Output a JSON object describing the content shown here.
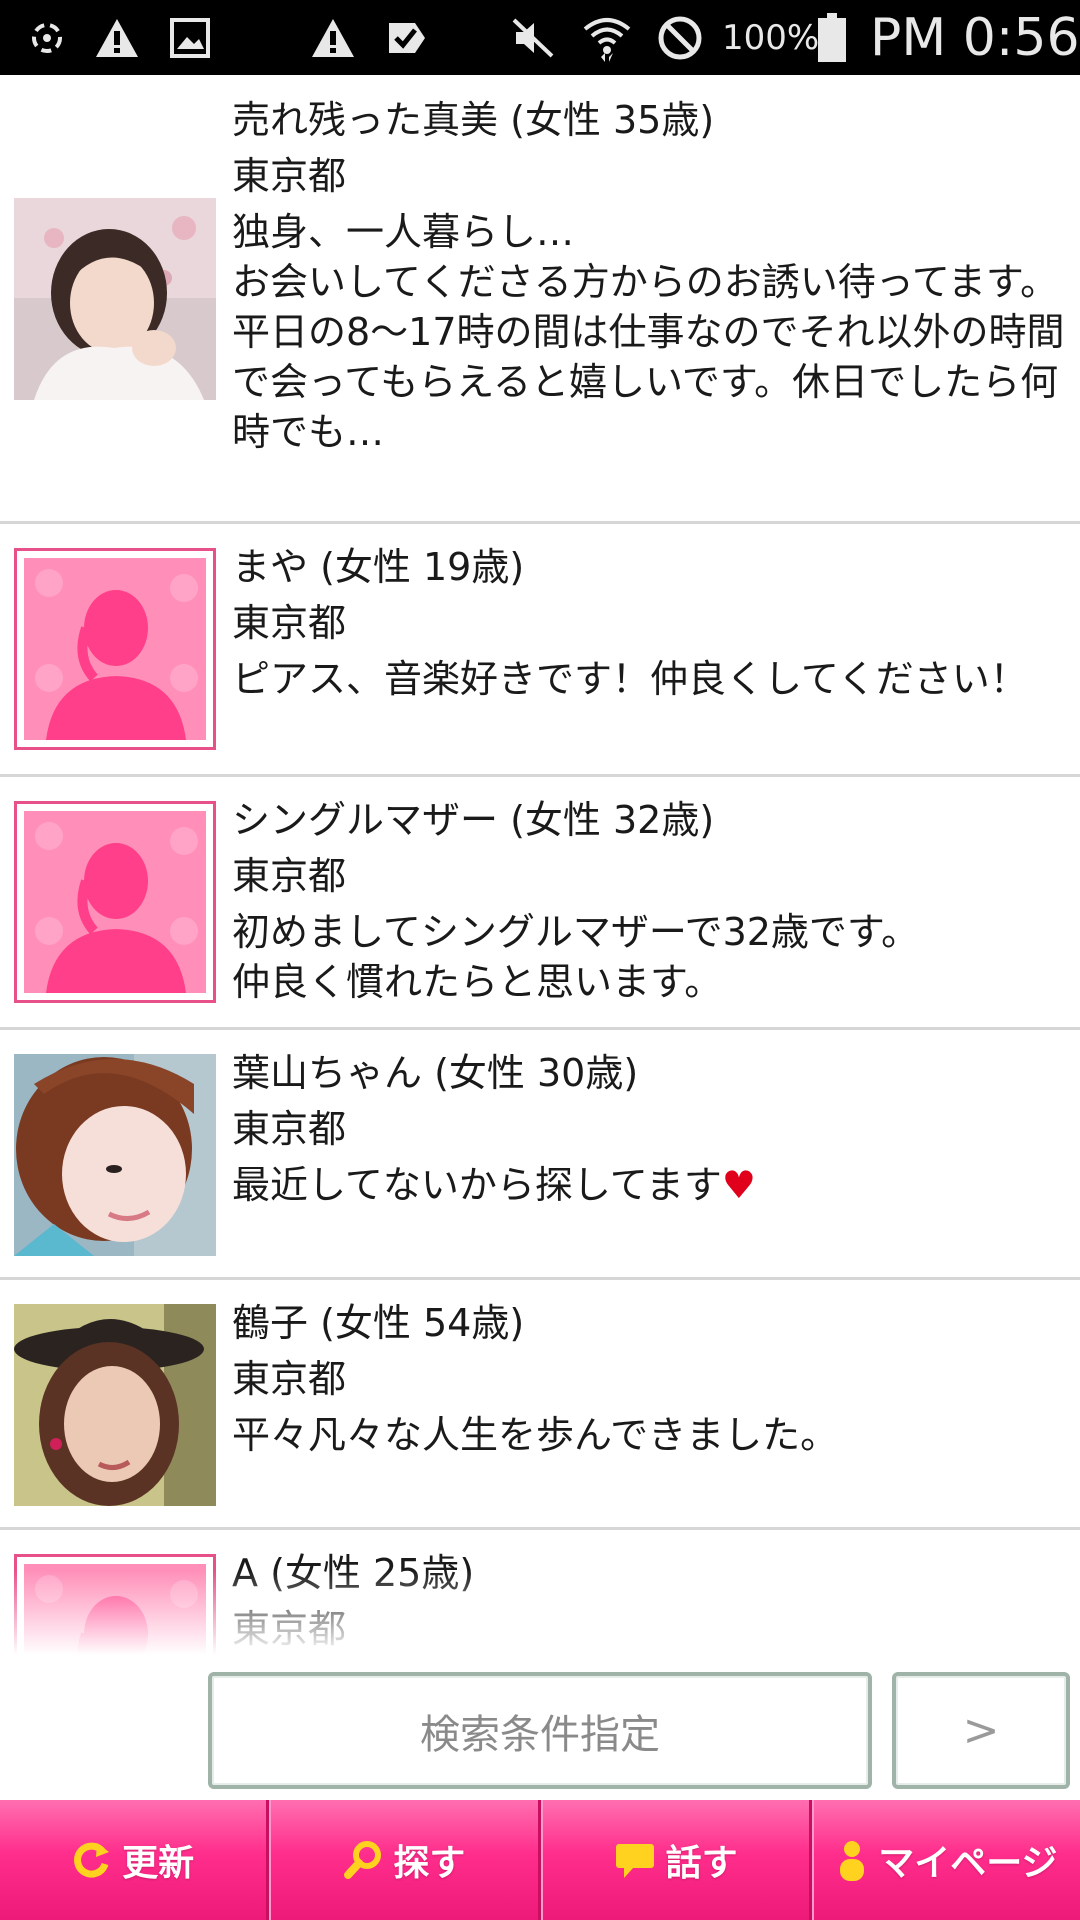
{
  "status_bar": {
    "battery": "100%",
    "time": "PM 0:56"
  },
  "feed": [
    {
      "name": "売れ残った真美 (女性 35歳)",
      "location": "東京都",
      "message": "独身、一人暮らし…\nお会いしてくださる方からのお誘い待ってます。\n平日の8〜17時の間は仕事なのでそれ以外の時間で会ってもらえると嬉しいです。休日でしたら何時でも…",
      "avatar": "photo"
    },
    {
      "name": "まや (女性 19歳)",
      "location": "東京都",
      "message": "ピアス、音楽好きです！仲良くしてください！",
      "avatar": "placeholder"
    },
    {
      "name": "シングルマザー (女性 32歳)",
      "location": "東京都",
      "message": "初めましてシングルマザーで32歳です。\n仲良く慣れたらと思います。",
      "avatar": "placeholder"
    },
    {
      "name": "葉山ちゃん (女性 30歳)",
      "location": "東京都",
      "message": "最近してないから探してます",
      "message_suffix": "♥",
      "avatar": "photo"
    },
    {
      "name": "鶴子 (女性 54歳)",
      "location": "東京都",
      "message": "平々凡々な人生を歩んできました。",
      "avatar": "photo"
    },
    {
      "name": "A (女性 25歳)",
      "location": "東京都",
      "message": "",
      "avatar": "placeholder"
    }
  ],
  "search": {
    "button_label": "検索条件指定",
    "next_label": ">"
  },
  "nav": {
    "refresh": "更新",
    "search": "探す",
    "talk": "話す",
    "mypage": "マイページ"
  },
  "colors": {
    "nav_pink": "#ff2d8c",
    "placeholder_pink": "#ff8fb8",
    "heart_red": "#e0001b"
  },
  "icons": [
    "refresh-icon",
    "magnifier-icon",
    "speech-bubble-icon",
    "person-icon"
  ]
}
